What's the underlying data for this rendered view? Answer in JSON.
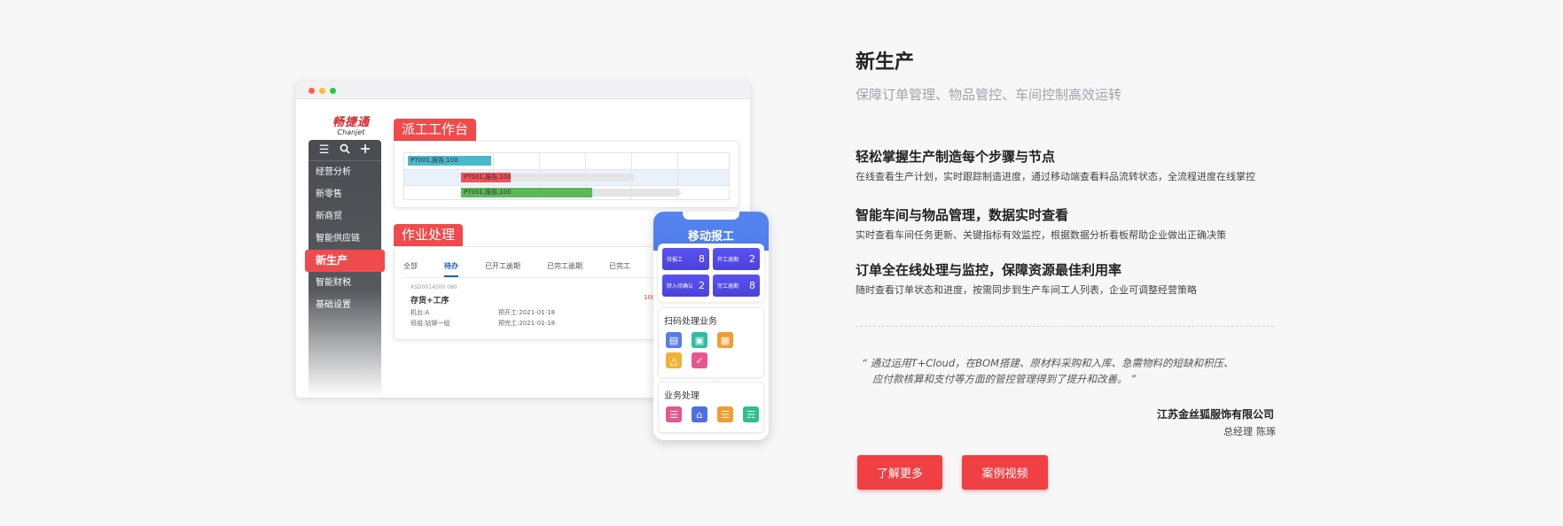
{
  "brand": {
    "cn": "畅捷通",
    "en": "Chanjet"
  },
  "sidebar": {
    "icons": [
      "menu-icon",
      "search-icon",
      "plus-icon"
    ],
    "items": [
      {
        "label": "经营分析"
      },
      {
        "label": "新零售"
      },
      {
        "label": "新商贸"
      },
      {
        "label": "智能供应链"
      },
      {
        "label": "新生产",
        "active": true
      },
      {
        "label": "智能财税"
      },
      {
        "label": "基础设置"
      }
    ]
  },
  "dispatch": {
    "tag": "派工工作台",
    "bars": [
      {
        "label": "PT001,报告,100",
        "color": "#4ab8cc"
      },
      {
        "label": "PT001,报告,100",
        "color": "#f0525a"
      },
      {
        "label": "PT001,报告,100",
        "color": "#5cb85c"
      }
    ]
  },
  "tasks": {
    "tag": "作业处理",
    "tabs": [
      "全部",
      "待办",
      "已开工逾期",
      "已完工逾期",
      "已完工"
    ],
    "active_tab": "待办",
    "order_no": "XSD0014500 080",
    "name": "存货+工序",
    "count": "100",
    "machine": "机台:A",
    "team": "班组:钻铆一组",
    "plan_start": "预开工:2021-01-18",
    "plan_end": "预完工:2021-01-18"
  },
  "mobile": {
    "title": "移动报工",
    "tiles": [
      {
        "label": "待报工",
        "value": "8"
      },
      {
        "label": "开工逾期",
        "value": "2"
      },
      {
        "label": "转入待确认",
        "value": "2"
      },
      {
        "label": "完工逾期",
        "value": "8"
      }
    ],
    "scan_title": "扫码处理业务",
    "scan_icons": [
      {
        "name": "scan-doc-icon",
        "color": "#5a7be8"
      },
      {
        "name": "scan-qr-icon",
        "color": "#2fbfa0"
      },
      {
        "name": "scan-box-icon",
        "color": "#f39c2f"
      },
      {
        "name": "scan-bag-icon",
        "color": "#f0b232"
      },
      {
        "name": "scan-check-icon",
        "color": "#e6568f"
      }
    ],
    "biz_title": "业务处理",
    "biz_icons": [
      {
        "name": "list-icon",
        "color": "#e6568f"
      },
      {
        "name": "home-icon",
        "color": "#4f6fe0"
      },
      {
        "name": "form-icon",
        "color": "#f39c2f"
      },
      {
        "name": "file-icon",
        "color": "#2fbf8a"
      }
    ]
  },
  "content": {
    "title": "新生产",
    "subtitle": "保障订单管理、物品管控、车间控制高效运转",
    "features": [
      {
        "title": "轻松掌握生产制造每个步骤与节点",
        "desc": "在线查看生产计划，实时跟踪制造进度，通过移动端查看料品流转状态，全流程进度在线掌控"
      },
      {
        "title": "智能车间与物品管理，数据实时查看",
        "desc": "实时查看车间任务更新、关键指标有效监控，根据数据分析看板帮助企业做出正确决策"
      },
      {
        "title": "订单全在线处理与监控，保障资源最佳利用率",
        "desc": "随时查看订单状态和进度，按需同步到生产车间工人列表，企业可调整经营策略"
      }
    ],
    "quote_line1": "“ 通过运用T+Cloud，在BOM搭建、原材料采购和入库、急需物料的短缺和积压、",
    "quote_line2": "应付款核算和支付等方面的管控管理得到了提升和改善。 ”",
    "company": "江苏金丝狐服饰有限公司",
    "person_role": "总经理",
    "person_name": "陈琢",
    "btn_more": "了解更多",
    "btn_video": "案例视频"
  }
}
